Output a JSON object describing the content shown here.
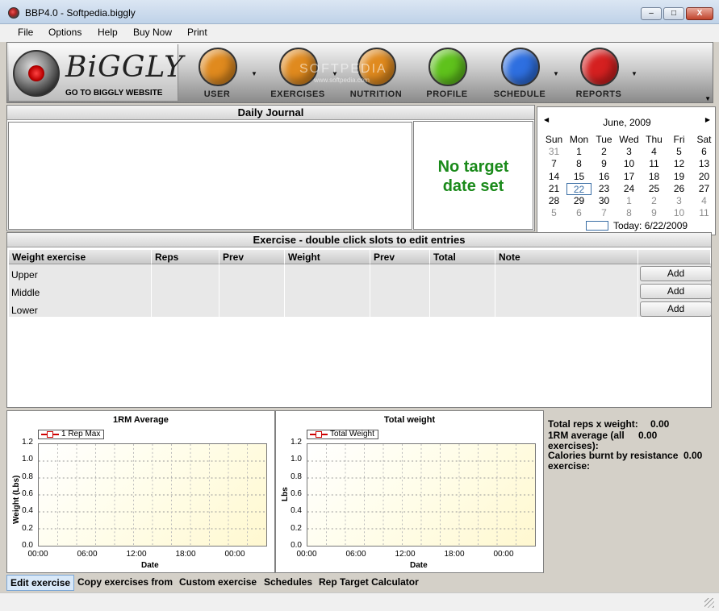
{
  "window": {
    "title": "BBP4.0 - Softpedia.biggly",
    "min": "–",
    "max": "□",
    "close": "X"
  },
  "menu": [
    "File",
    "Options",
    "Help",
    "Buy Now",
    "Print"
  ],
  "logo": {
    "text": "BiGGLY",
    "link": "GO TO BIGGLY WEBSITE",
    "ball_text": "BIGGLY"
  },
  "toolbar": {
    "items": [
      {
        "label": "USER",
        "icon": "user-icon",
        "color": "#e08a1e",
        "dropdown": true
      },
      {
        "label": "EXERCISES",
        "icon": "dumbbell-icon",
        "color": "#e08a1e",
        "dropdown": true
      },
      {
        "label": "NUTRITION",
        "icon": "bowl-icon",
        "color": "#e08a1e",
        "dropdown": false
      },
      {
        "label": "PROFILE",
        "icon": "profile-icon",
        "color": "#5fc21c",
        "dropdown": false
      },
      {
        "label": "SCHEDULE",
        "icon": "schedule-icon",
        "color": "#2e6fe0",
        "dropdown": true
      },
      {
        "label": "REPORTS",
        "icon": "reports-icon",
        "color": "#d52020",
        "dropdown": true
      }
    ],
    "watermark": "SOFTPEDIA",
    "watermark_url": "www.softpedia.com"
  },
  "journal": {
    "title": "Daily Journal"
  },
  "target": {
    "line1": "No target",
    "line2": "date set"
  },
  "calendar": {
    "month": "June, 2009",
    "days": [
      "Sun",
      "Mon",
      "Tue",
      "Wed",
      "Thu",
      "Fri",
      "Sat"
    ],
    "weeks": [
      [
        "31",
        "1",
        "2",
        "3",
        "4",
        "5",
        "6"
      ],
      [
        "7",
        "8",
        "9",
        "10",
        "11",
        "12",
        "13"
      ],
      [
        "14",
        "15",
        "16",
        "17",
        "18",
        "19",
        "20"
      ],
      [
        "21",
        "22",
        "23",
        "24",
        "25",
        "26",
        "27"
      ],
      [
        "28",
        "29",
        "30",
        "1",
        "2",
        "3",
        "4"
      ],
      [
        "5",
        "6",
        "7",
        "8",
        "9",
        "10",
        "11"
      ]
    ],
    "selected": "22",
    "today": "Today: 6/22/2009"
  },
  "exercise": {
    "title": "Exercise - double click slots to edit entries",
    "columns": [
      "Weight exercise",
      "Reps",
      "Prev",
      "Weight",
      "Prev",
      "Total",
      "Note"
    ],
    "rows": [
      "Upper",
      "Middle",
      "Lower"
    ],
    "add_label": "Add"
  },
  "charts": {
    "left": {
      "title": "1RM Average",
      "legend": "1 Rep Max",
      "ylabel": "Weight (Lbs)",
      "xlabel": "Date"
    },
    "right": {
      "title": "Total weight",
      "legend": "Total Weight",
      "ylabel": "Lbs",
      "xlabel": "Date"
    },
    "yticks": [
      "1.2",
      "1.0",
      "0.8",
      "0.6",
      "0.4",
      "0.2",
      "0.0"
    ],
    "xticks": [
      "00:00",
      "06:00",
      "12:00",
      "18:00",
      "00:00"
    ]
  },
  "chart_data": [
    {
      "type": "line",
      "title": "1RM Average",
      "xlabel": "Date",
      "ylabel": "Weight (Lbs)",
      "series": [
        {
          "name": "1 Rep Max",
          "values": []
        }
      ],
      "ylim": [
        0,
        1.2
      ],
      "x_ticks": [
        "00:00",
        "06:00",
        "12:00",
        "18:00",
        "00:00"
      ],
      "grid": true,
      "legend": "top-left"
    },
    {
      "type": "line",
      "title": "Total weight",
      "xlabel": "Date",
      "ylabel": "Lbs",
      "series": [
        {
          "name": "Total Weight",
          "values": []
        }
      ],
      "ylim": [
        0,
        1.2
      ],
      "x_ticks": [
        "00:00",
        "06:00",
        "12:00",
        "18:00",
        "00:00"
      ],
      "grid": true,
      "legend": "top-left"
    }
  ],
  "stats": {
    "reps_label": "Total reps x weight:",
    "reps_value": "0.00",
    "avg_label1": "1RM average (all",
    "avg_value": "0.00",
    "avg_label2": "exercises):",
    "cal_label1": "Calories burnt by resistance",
    "cal_value": "0.00",
    "cal_label2": "exercise:"
  },
  "bottom_tabs": [
    "Edit exercise",
    "Copy exercises from",
    "Custom exercise",
    "Schedules",
    "Rep Target Calculator"
  ]
}
